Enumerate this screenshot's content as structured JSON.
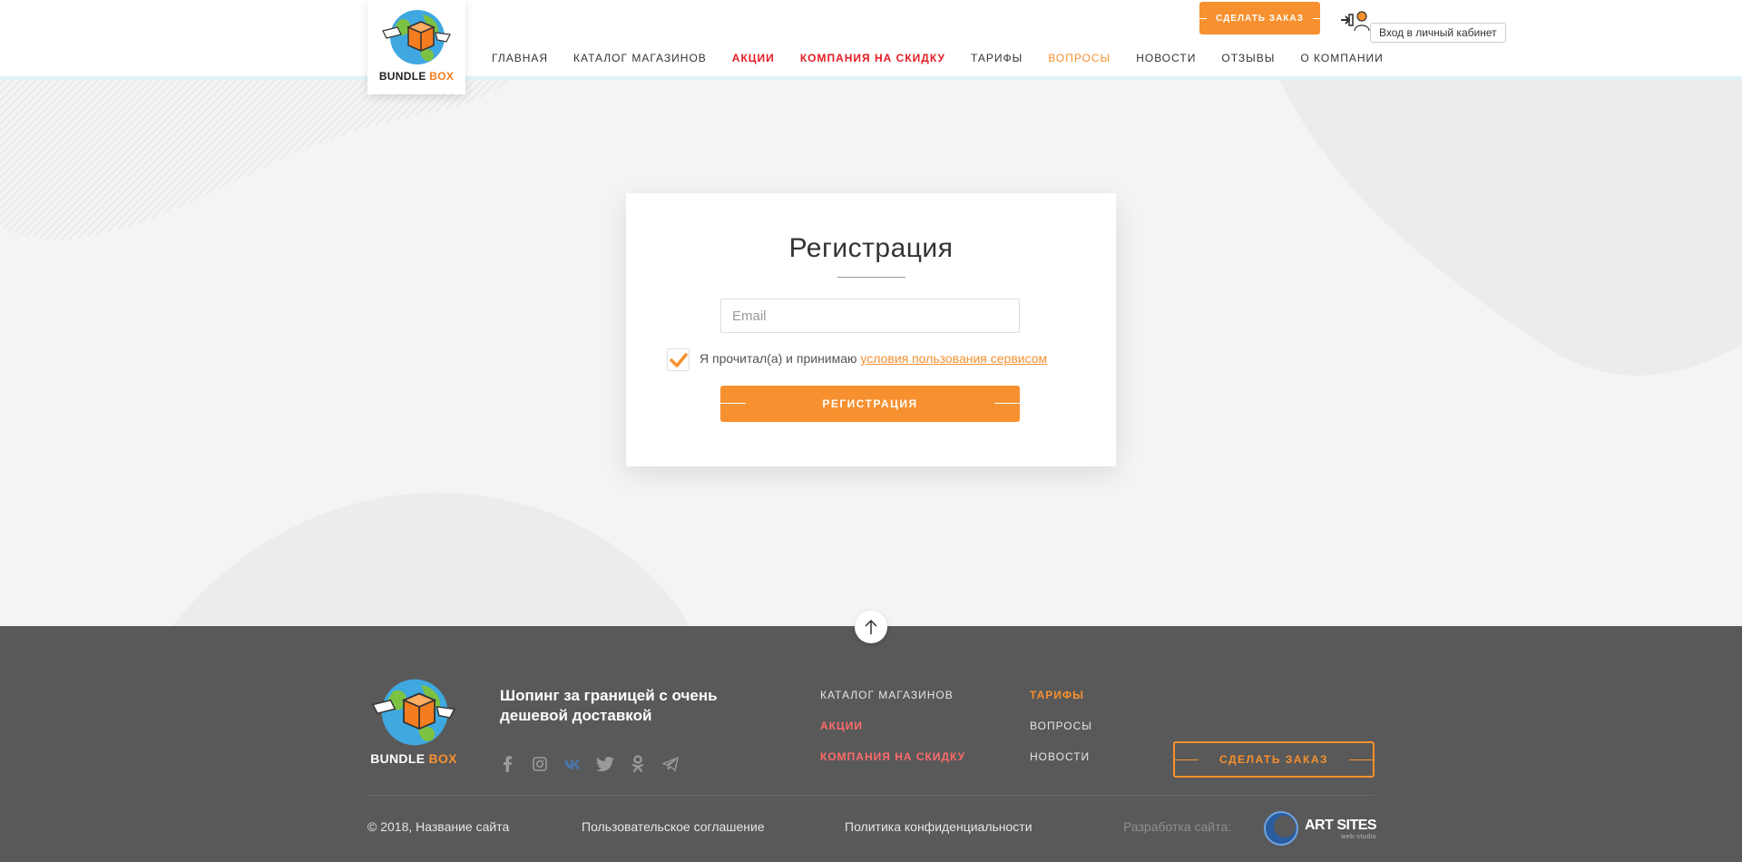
{
  "header": {
    "logo_text_main": "BUNDLE ",
    "logo_text_accent": "BOX",
    "nav": [
      {
        "label": "ГЛАВНАЯ",
        "style": "normal"
      },
      {
        "label": "КАТАЛОГ МАГАЗИНОВ",
        "style": "normal"
      },
      {
        "label": "АКЦИИ",
        "style": "red"
      },
      {
        "label": "КОМПАНИЯ НА СКИДКУ",
        "style": "red"
      },
      {
        "label": "ТАРИФЫ",
        "style": "normal"
      },
      {
        "label": "ВОПРОСЫ",
        "style": "active"
      },
      {
        "label": "НОВОСТИ",
        "style": "normal"
      },
      {
        "label": "ОТЗЫВЫ",
        "style": "normal"
      },
      {
        "label": "О КОМПАНИИ",
        "style": "normal"
      }
    ],
    "order_button": "СДЕЛАТЬ ЗАКАЗ",
    "login_tooltip": "Вход в личный кабинет"
  },
  "registration": {
    "title": "Регистрация",
    "email_placeholder": "Email",
    "agree_text": "Я прочитал(а) и принимаю ",
    "agree_link": "условия пользования сервисом",
    "checked": true,
    "submit_label": "РЕГИСТРАЦИЯ"
  },
  "footer": {
    "logo_text_main": "BUNDLE ",
    "logo_text_accent": "BOX",
    "slogan": "Шопинг за границей с очень дешевой доставкой",
    "socials": [
      "facebook-icon",
      "instagram-icon",
      "vk-icon",
      "twitter-icon",
      "odnoklassniki-icon",
      "telegram-icon"
    ],
    "links_col1": [
      {
        "label": "КАТАЛОГ МАГАЗИНОВ",
        "style": "normal"
      },
      {
        "label": "АКЦИИ",
        "style": "red"
      },
      {
        "label": "КОМПАНИЯ НА СКИДКУ",
        "style": "red"
      }
    ],
    "links_col2": [
      {
        "label": "ТАРИФЫ",
        "style": "active"
      },
      {
        "label": "ВОПРОСЫ",
        "style": "normal"
      },
      {
        "label": "НОВОСТИ",
        "style": "normal"
      }
    ],
    "order_button": "СДЕЛАТЬ ЗАКАЗ",
    "copyright": "© 2018, Название сайта",
    "user_agreement": "Пользовательское соглашение",
    "privacy": "Политика конфиденциальности",
    "dev_label": "Разработка сайта:",
    "dev_name": "ART SITES",
    "dev_sub": "web-studio"
  },
  "colors": {
    "accent": "#f7902f",
    "red": "#e51c23",
    "footer_bg": "#595959"
  }
}
